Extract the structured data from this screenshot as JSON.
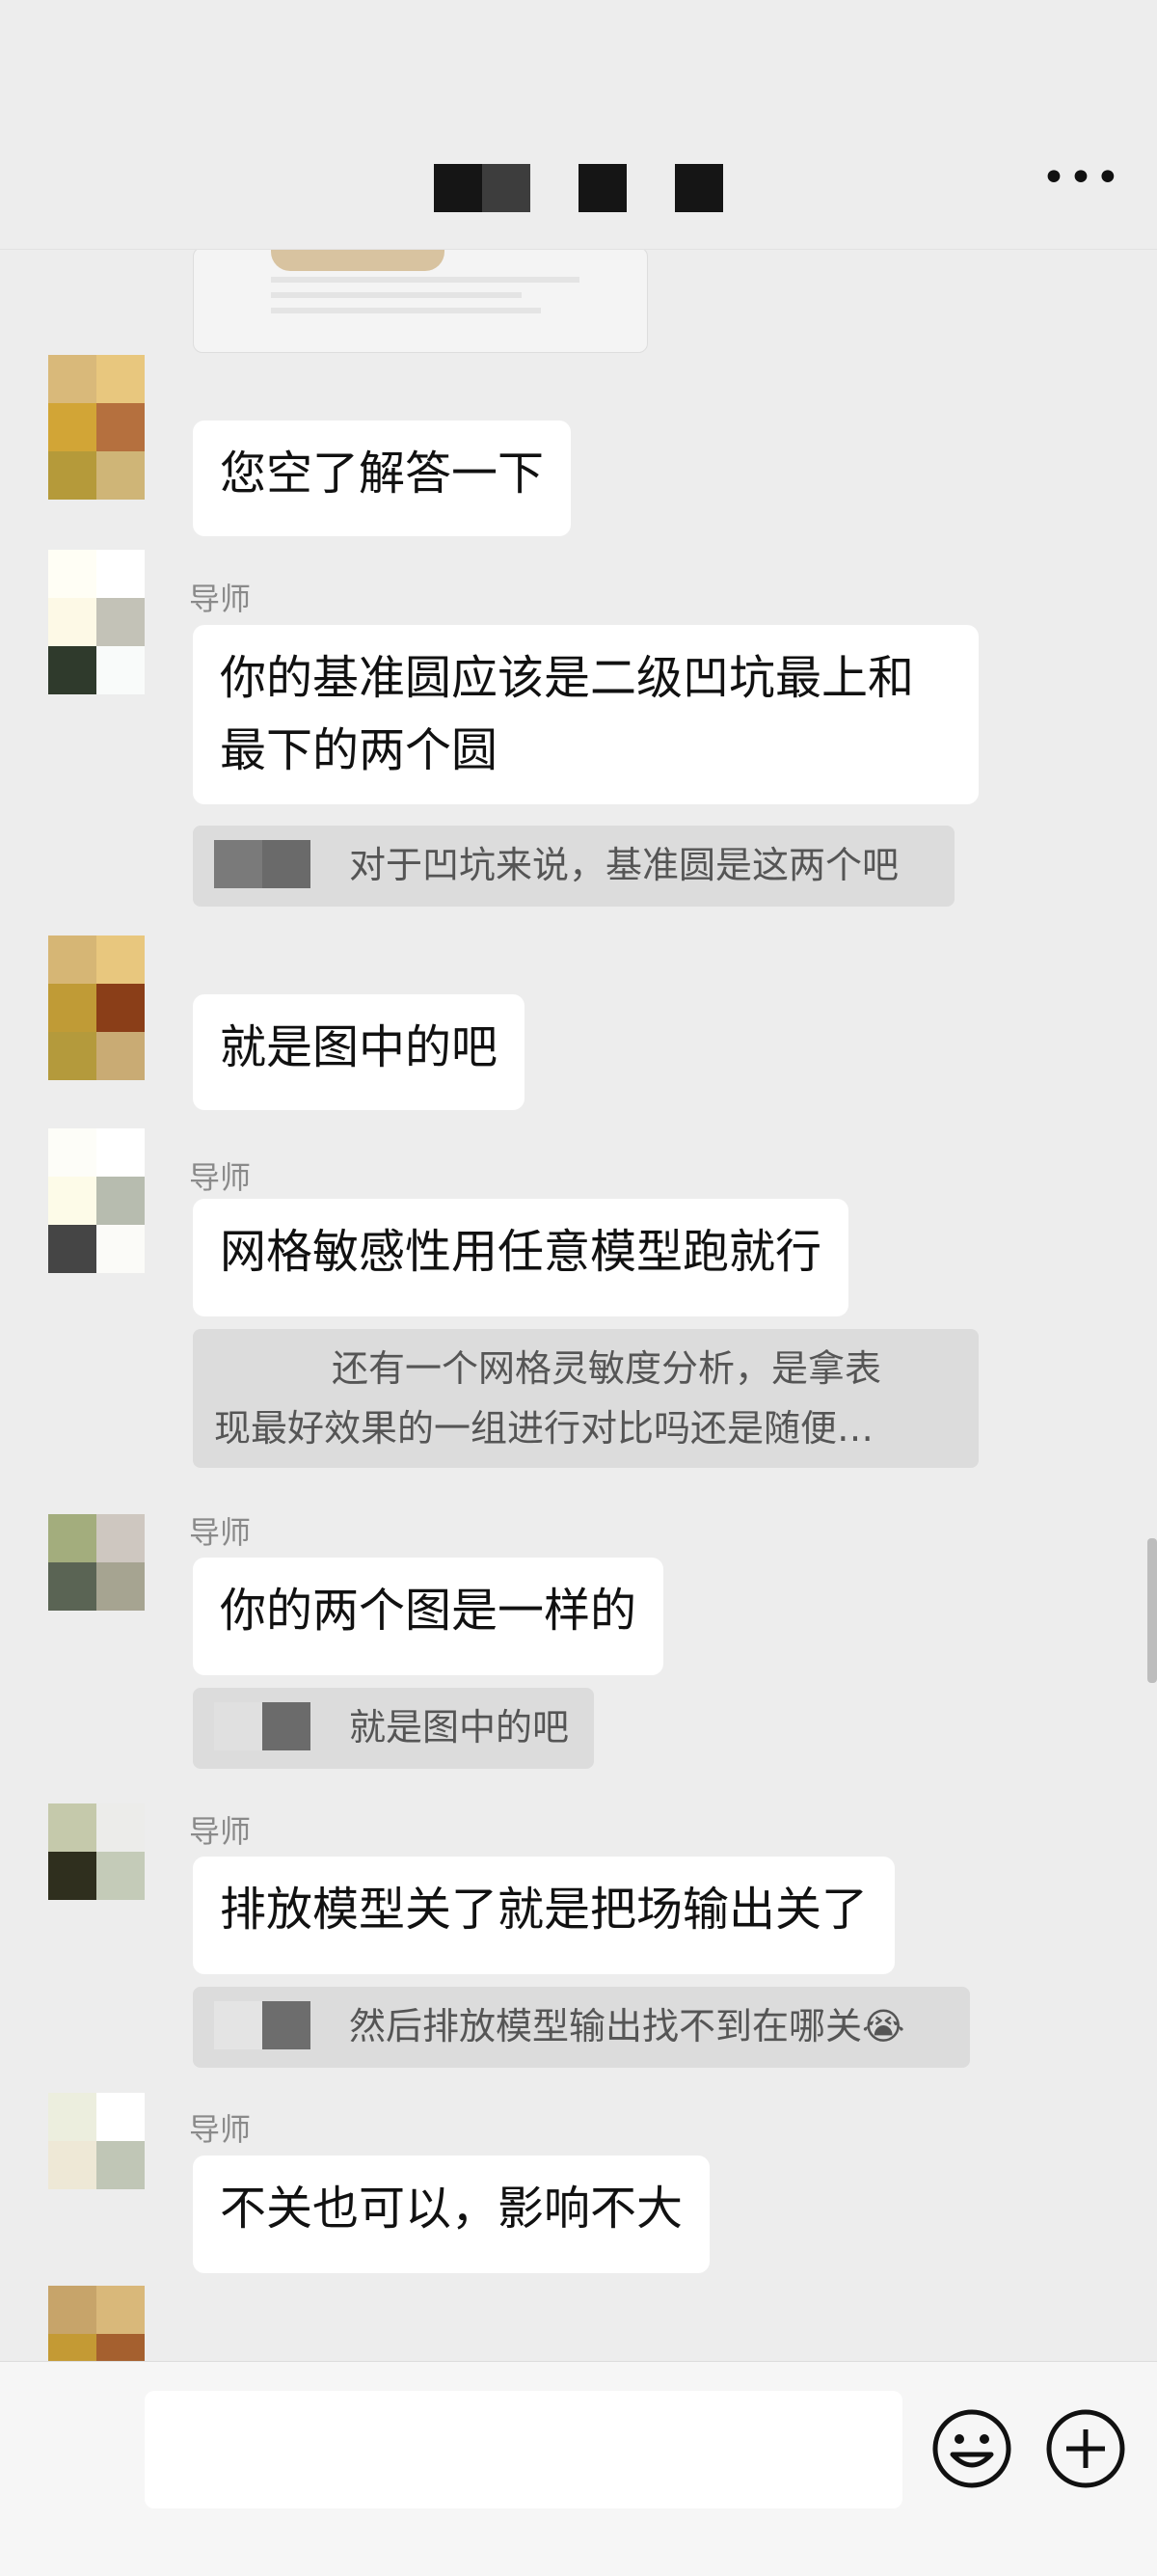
{
  "header": {
    "title_redacted": true,
    "more_icon": "more-icon"
  },
  "messages": {
    "m1": {
      "text": "您空了解答一下"
    },
    "m2": {
      "sender": "导师",
      "text_line1": "你的基准圆应该是二级凹坑最上和",
      "text_line2": "最下的两个圆",
      "quote": "对于凹坑来说，基准圆是这两个吧"
    },
    "m3": {
      "text": "就是图中的吧"
    },
    "m4": {
      "sender": "导师",
      "text": "网格敏感性用任意模型跑就行",
      "quote_line1": "还有一个网格灵敏度分析，是拿表",
      "quote_line2": "现最好效果的一组进行对比吗还是随便…"
    },
    "m5": {
      "sender": "导师",
      "text": "你的两个图是一样的",
      "quote": "就是图中的吧"
    },
    "m6": {
      "sender": "导师",
      "text": "排放模型关了就是把场输出关了",
      "quote": "然后排放模型输出找不到在哪关😭"
    },
    "m7": {
      "sender": "导师",
      "text": "不关也可以，影响不大"
    }
  },
  "input": {
    "placeholder": "",
    "value": ""
  },
  "icons": {
    "emoji": "emoji-icon",
    "add": "plus-icon"
  }
}
